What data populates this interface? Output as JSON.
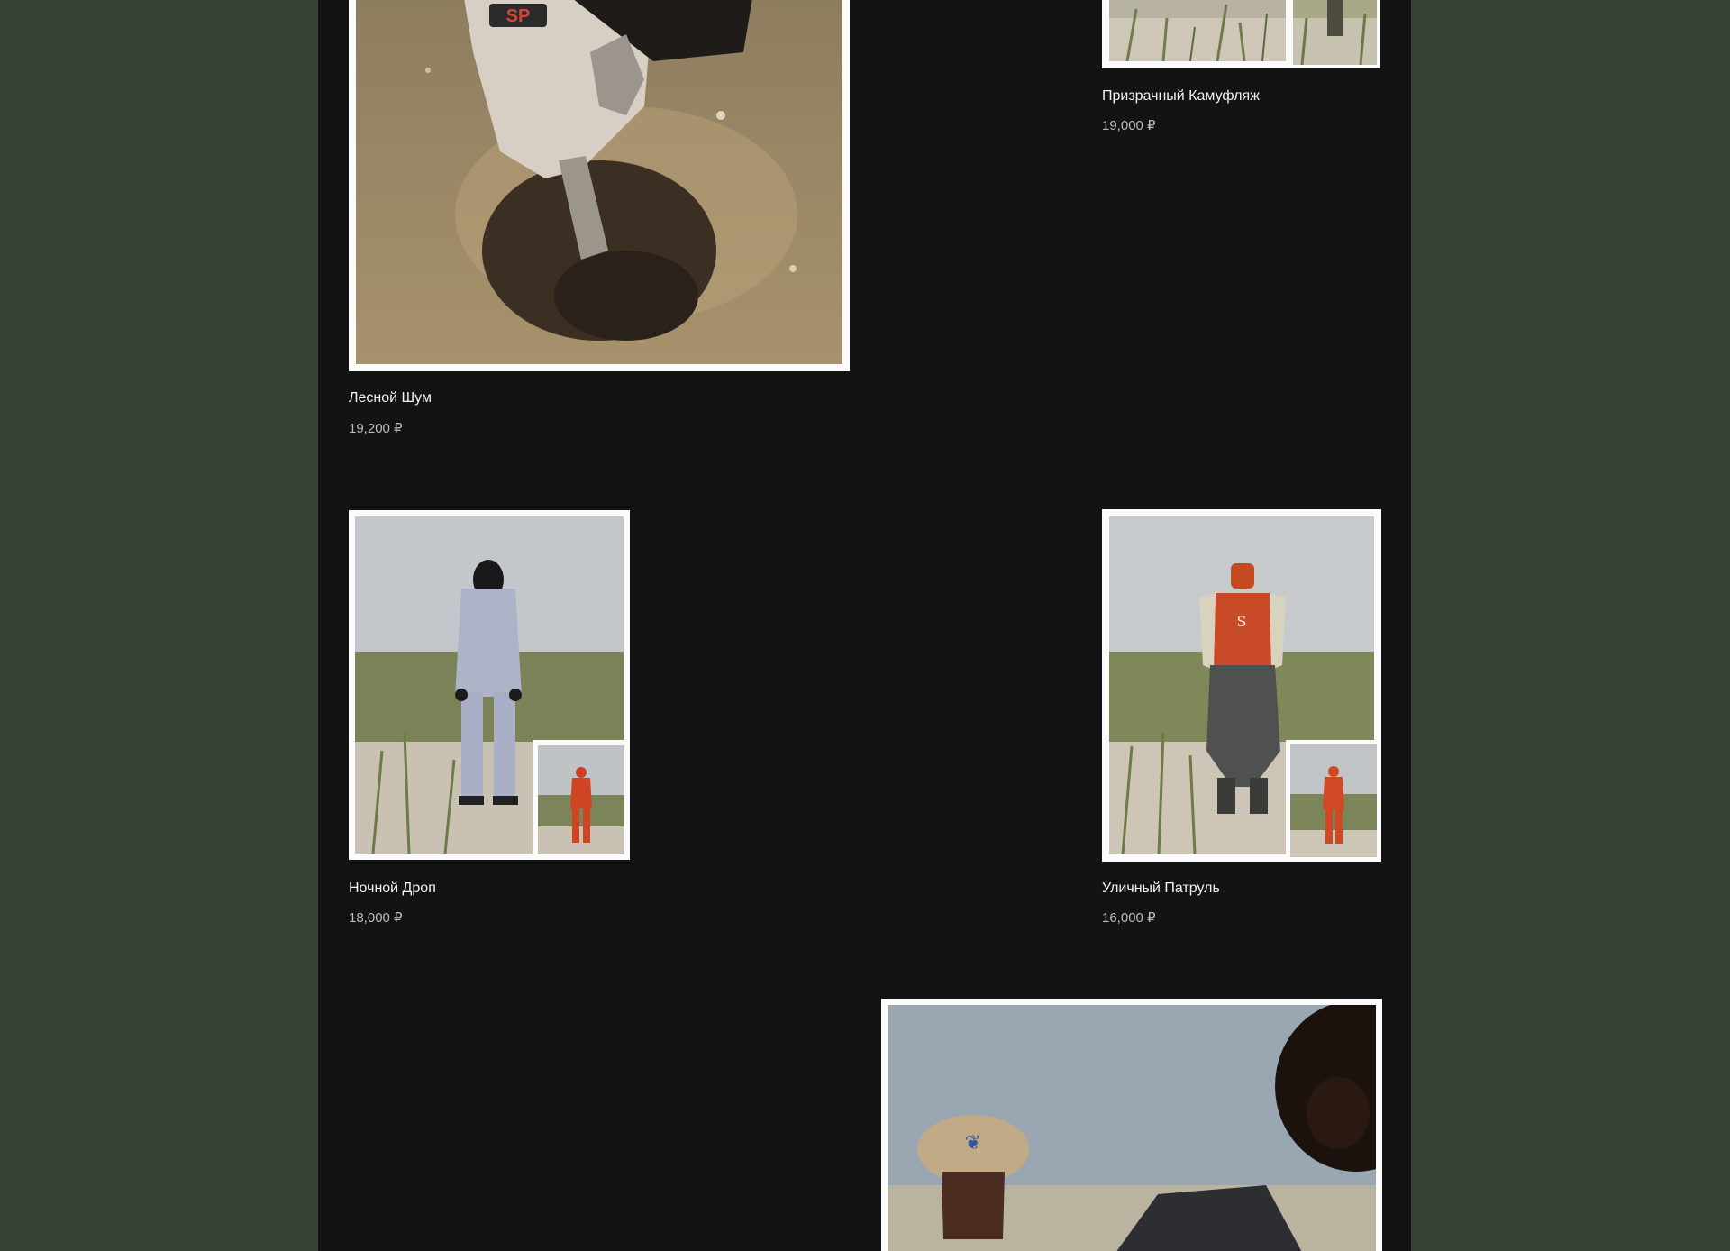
{
  "products": [
    {
      "name": "Лесной Шум",
      "price": "19,200 ₽"
    },
    {
      "name": "Призрачный Камуфляж",
      "price": "19,000 ₽"
    },
    {
      "name": "Ночной Дроп",
      "price": "18,000 ₽"
    },
    {
      "name": "Уличный Патруль",
      "price": "16,000 ₽"
    },
    {
      "name": "",
      "price": ""
    }
  ],
  "photo_badge_text": "SP",
  "colors": {
    "page_background": "#364135",
    "content_background": "#131313",
    "frame": "#fbfbfb",
    "name_text": "#f2f2f2",
    "price_text": "#bdbdbd"
  }
}
